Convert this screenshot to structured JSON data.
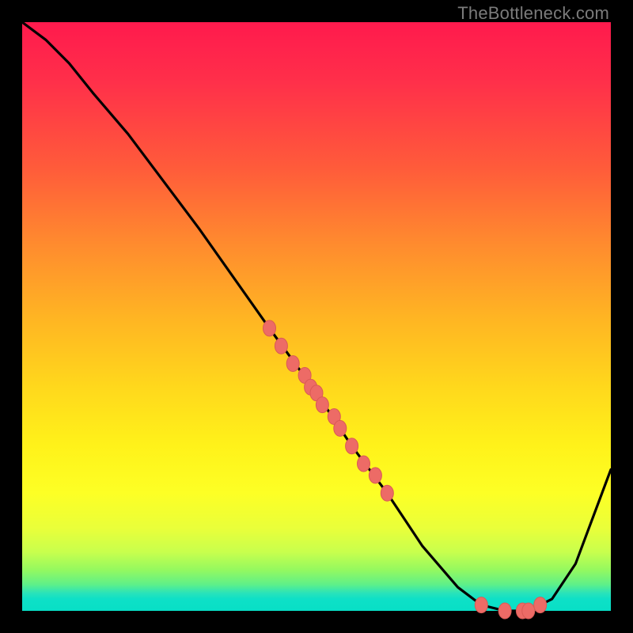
{
  "watermark": "TheBottleneck.com",
  "chart_data": {
    "type": "line",
    "title": "",
    "xlabel": "",
    "ylabel": "",
    "xlim": [
      0,
      100
    ],
    "ylim": [
      0,
      100
    ],
    "curve": {
      "x": [
        0,
        4,
        8,
        12,
        18,
        30,
        42,
        50,
        56,
        62,
        68,
        74,
        78,
        82,
        86,
        90,
        94,
        100
      ],
      "y": [
        100,
        97,
        93,
        88,
        81,
        65,
        48,
        37,
        28,
        20,
        11,
        4,
        1,
        0,
        0,
        2,
        8,
        24
      ]
    },
    "series": [
      {
        "name": "markers-on-curve",
        "x": [
          42,
          44,
          46,
          48,
          49,
          50,
          51,
          53,
          54,
          56,
          58,
          60,
          62,
          78,
          82,
          85,
          86,
          88
        ],
        "y": [
          48,
          45,
          42,
          40,
          38,
          37,
          35,
          33,
          31,
          28,
          25,
          23,
          20,
          1,
          0,
          0,
          0,
          1
        ]
      }
    ],
    "colors": {
      "curve": "#000000",
      "marker_fill": "#ed6b66",
      "marker_stroke": "#d95a55"
    }
  }
}
